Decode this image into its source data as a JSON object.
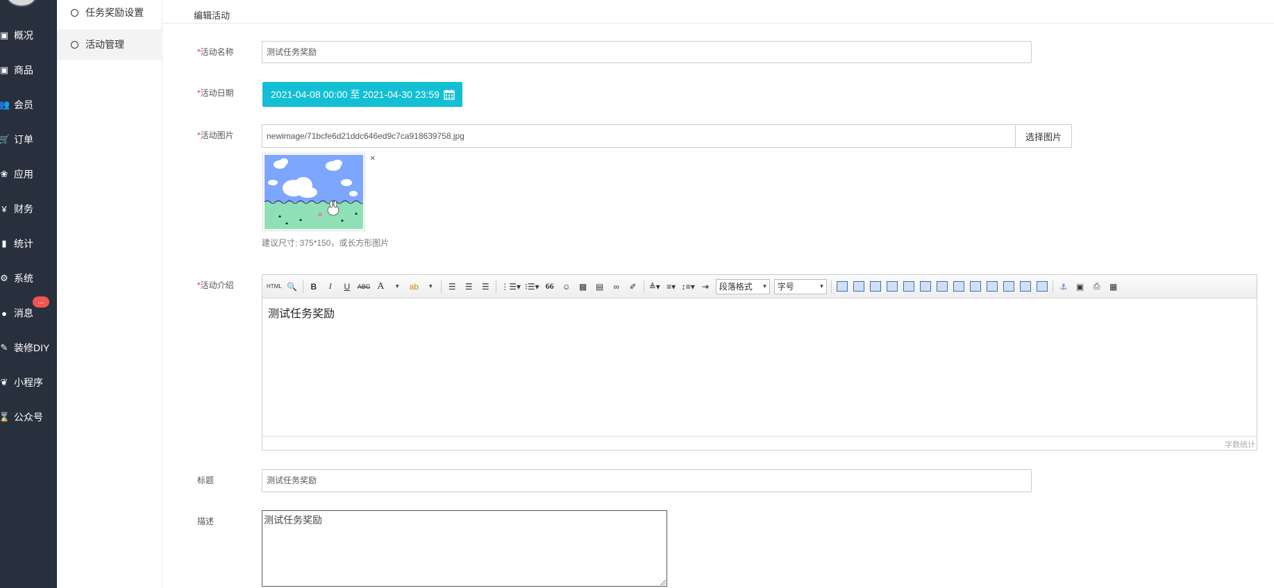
{
  "nav": {
    "items": [
      {
        "icon": "inbox-icon",
        "glyph": "▣",
        "label": "概况"
      },
      {
        "icon": "goods-icon",
        "glyph": "▣",
        "label": "商品"
      },
      {
        "icon": "users-icon",
        "glyph": "👥",
        "label": "会员"
      },
      {
        "icon": "cart-icon",
        "glyph": "🛒",
        "label": "订单"
      },
      {
        "icon": "apps-icon",
        "glyph": "❀",
        "label": "应用"
      },
      {
        "icon": "yen-icon",
        "glyph": "¥",
        "label": "财务"
      },
      {
        "icon": "stats-icon",
        "glyph": "▮",
        "label": "统计"
      },
      {
        "icon": "gears-icon",
        "glyph": "⚙",
        "label": "系统"
      },
      {
        "icon": "chat-icon",
        "glyph": "●",
        "label": "消息"
      },
      {
        "icon": "hammer-icon",
        "glyph": "✎",
        "label": "装修DIY"
      },
      {
        "icon": "wechat-icon",
        "glyph": "❦",
        "label": "小程序"
      },
      {
        "icon": "hourglass-icon",
        "glyph": "⌛",
        "label": "公众号"
      }
    ],
    "badge": "..."
  },
  "subnav": {
    "items": [
      {
        "label": "任务奖励设置",
        "active": false
      },
      {
        "label": "活动管理",
        "active": true
      }
    ]
  },
  "page": {
    "tab_title": "编辑活动"
  },
  "form": {
    "required_mark": "*",
    "name": {
      "label": "活动名称",
      "value": "测试任务奖励"
    },
    "date": {
      "label": "活动日期",
      "value": "2021-04-08 00:00 至 2021-04-30 23:59"
    },
    "image": {
      "label": "活动图片",
      "value": "newimage/71bcfe6d21ddc646ed9c7ca918639758.jpg",
      "choose_label": "选择图片",
      "remove": "×",
      "hint": "建议尺寸: 375*150，或长方形图片"
    },
    "intro": {
      "label": "活动介绍",
      "content": "测试任务奖励",
      "toolbar": {
        "html": "HTML",
        "bold": "B",
        "italic": "I",
        "underline": "U",
        "strike": "ABC",
        "font_color": "A",
        "quote": "66",
        "paragraph": "段落格式",
        "font_size": "字号"
      },
      "word_count": "字数统计"
    },
    "title": {
      "label": "标题",
      "value": "测试任务奖励"
    },
    "desc": {
      "label": "描述",
      "value": "测试任务奖励"
    }
  },
  "colors": {
    "nav_bg": "#28303e",
    "accent": "#13bfd4",
    "required": "#ee3333",
    "badge": "#f25353"
  }
}
